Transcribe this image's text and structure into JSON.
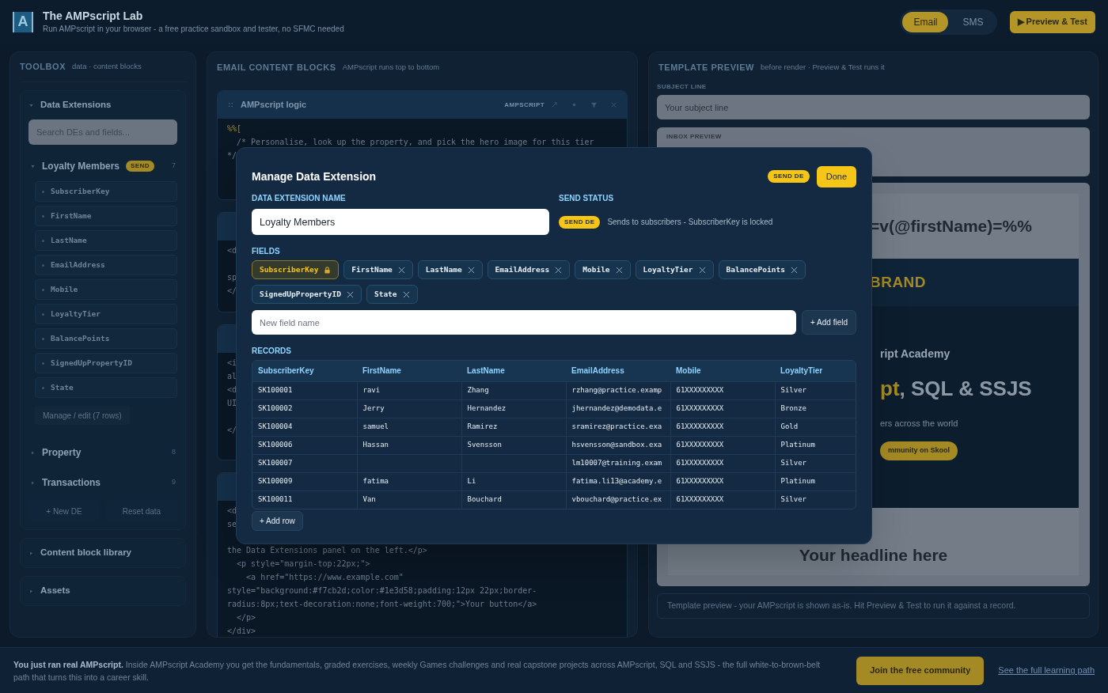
{
  "header": {
    "logo": "A",
    "title": "The AMPscript Lab",
    "subtitle": "Run AMPscript in your browser - a free practice sandbox and tester, no SFMC needed",
    "channel_tabs": [
      {
        "label": "Email",
        "selected": true
      },
      {
        "label": "SMS",
        "selected": false
      }
    ],
    "preview_button": "▶ Preview & Test"
  },
  "toolbox": {
    "title": "TOOLBOX",
    "subtitle": "data · content blocks",
    "sections": [
      {
        "kind": "data",
        "title": "Data Extensions",
        "expanded": true,
        "search_placeholder": "Search DEs and fields...",
        "data_extensions": [
          {
            "name": "Loyalty Members",
            "badge": "SEND",
            "count": "7",
            "expanded": true,
            "fields": [
              "SubscriberKey",
              "FirstName",
              "LastName",
              "EmailAddress",
              "Mobile",
              "LoyaltyTier",
              "BalancePoints",
              "SignedUpPropertyID",
              "State"
            ],
            "manage_button": "Manage / edit (7 rows)"
          },
          {
            "name": "Property",
            "count": "8",
            "expanded": false
          },
          {
            "name": "Transactions",
            "count": "9",
            "expanded": false
          }
        ],
        "buttons": [
          "+ New DE",
          "Reset data"
        ]
      },
      {
        "kind": "plain",
        "title": "Content block library",
        "expanded": false
      },
      {
        "kind": "plain",
        "title": "Assets",
        "expanded": false
      }
    ]
  },
  "content": {
    "title": "EMAIL CONTENT BLOCKS",
    "subtitle": "AMPscript runs top to bottom",
    "blocks": [
      {
        "title": "AMPscript logic",
        "tag": "AMPSCRIPT",
        "lines": [
          "%%[",
          "  /* Personalise, look up the property, and pick the hero image for this tier",
          "*/"
        ]
      },
      {
        "lines": [
          "<d",
          "sp",
          "</"
        ]
      },
      {
        "lines": [
          "<i",
          "al",
          "<d",
          "UI",
          "</"
        ]
      },
      {
        "lines": [
          "<d",
          "se",
          "the Data Extensions panel on the left.</p>",
          "  <p style=\"margin-top:22px;\">",
          "    <a href=\"https://www.example.com\"",
          "style=\"background:#f7cb2d;color:#1e3d58;padding:12px 22px;border-",
          "radius:8px;text-decoration:none;font-weight:700;\">Your button</a>",
          "  </p>",
          "</div>"
        ]
      }
    ]
  },
  "preview": {
    "title": "TEMPLATE PREVIEW",
    "subtitle": "before render · Preview & Test runs it",
    "subject_label": "SUBJECT LINE",
    "subject_value": "Your subject line",
    "inbox_label": "INBOX PREVIEW",
    "email": {
      "greeting": "=v(@firstName)=%%",
      "brand": "BRAND",
      "hero_kicker": "ript Academy",
      "hero_title_accent": "pt",
      "hero_title_rest": ", SQL & SSJS",
      "hero_text": "ers across the world",
      "hero_button": "mmunity on Skool",
      "headline": "Your headline here"
    },
    "footnote": "Template preview - your AMPscript is shown as-is. Hit Preview & Test to run it against a record."
  },
  "modal": {
    "title": "Manage Data Extension",
    "badge": "SEND DE",
    "done_button": "Done",
    "name_label": "DATA EXTENSION NAME",
    "name_value": "Loyalty Members",
    "status_label": "SEND STATUS",
    "status_badge": "SEND DE",
    "status_text": "Sends to subscribers - SubscriberKey is locked",
    "fields_label": "FIELDS",
    "fields": [
      {
        "name": "SubscriberKey",
        "locked": true
      },
      {
        "name": "FirstName",
        "locked": false
      },
      {
        "name": "LastName",
        "locked": false
      },
      {
        "name": "EmailAddress",
        "locked": false
      },
      {
        "name": "Mobile",
        "locked": false
      },
      {
        "name": "LoyaltyTier",
        "locked": false
      },
      {
        "name": "BalancePoints",
        "locked": false
      },
      {
        "name": "SignedUpPropertyID",
        "locked": false
      },
      {
        "name": "State",
        "locked": false
      }
    ],
    "new_field_placeholder": "New field name",
    "add_field_button": "+ Add field",
    "records_label": "RECORDS",
    "table": {
      "columns": [
        "SubscriberKey",
        "FirstName",
        "LastName",
        "EmailAddress",
        "Mobile",
        "LoyaltyTier"
      ],
      "rows": [
        [
          "SK100001",
          "ravi",
          "Zhang",
          "rzhang@practice.examp",
          "61XXXXXXXXX",
          "Silver"
        ],
        [
          "SK100002",
          "Jerry",
          "Hernandez",
          "jhernandez@demodata.e",
          "61XXXXXXXXX",
          "Bronze"
        ],
        [
          "SK100004",
          "samuel",
          "Ramirez",
          "sramirez@practice.exa",
          "61XXXXXXXXX",
          "Gold"
        ],
        [
          "SK100006",
          "Hassan",
          "Svensson",
          "hsvensson@sandbox.exa",
          "61XXXXXXXXX",
          "Platinum"
        ],
        [
          "SK100007",
          "",
          "",
          "lm10007@training.exam",
          "61XXXXXXXXX",
          "Silver"
        ],
        [
          "SK100009",
          "fatima",
          "Li",
          "fatima.li13@academy.e",
          "61XXXXXXXXX",
          "Platinum"
        ],
        [
          "SK100011",
          "Van",
          "Bouchard",
          "vbouchard@practice.ex",
          "61XXXXXXXXX",
          "Silver"
        ]
      ]
    },
    "add_row_button": "+ Add row"
  },
  "footer": {
    "text": "**You just ran real AMPscript.** Inside AMPscript Academy you get the fundamentals, graded exercises, weekly Games challenges and real capstone projects across AMPscript, SQL and SSJS - the full white-to-brown-belt path that turns this into a career skill.",
    "join_button": "Join the free community",
    "link": "See the full learning path"
  }
}
